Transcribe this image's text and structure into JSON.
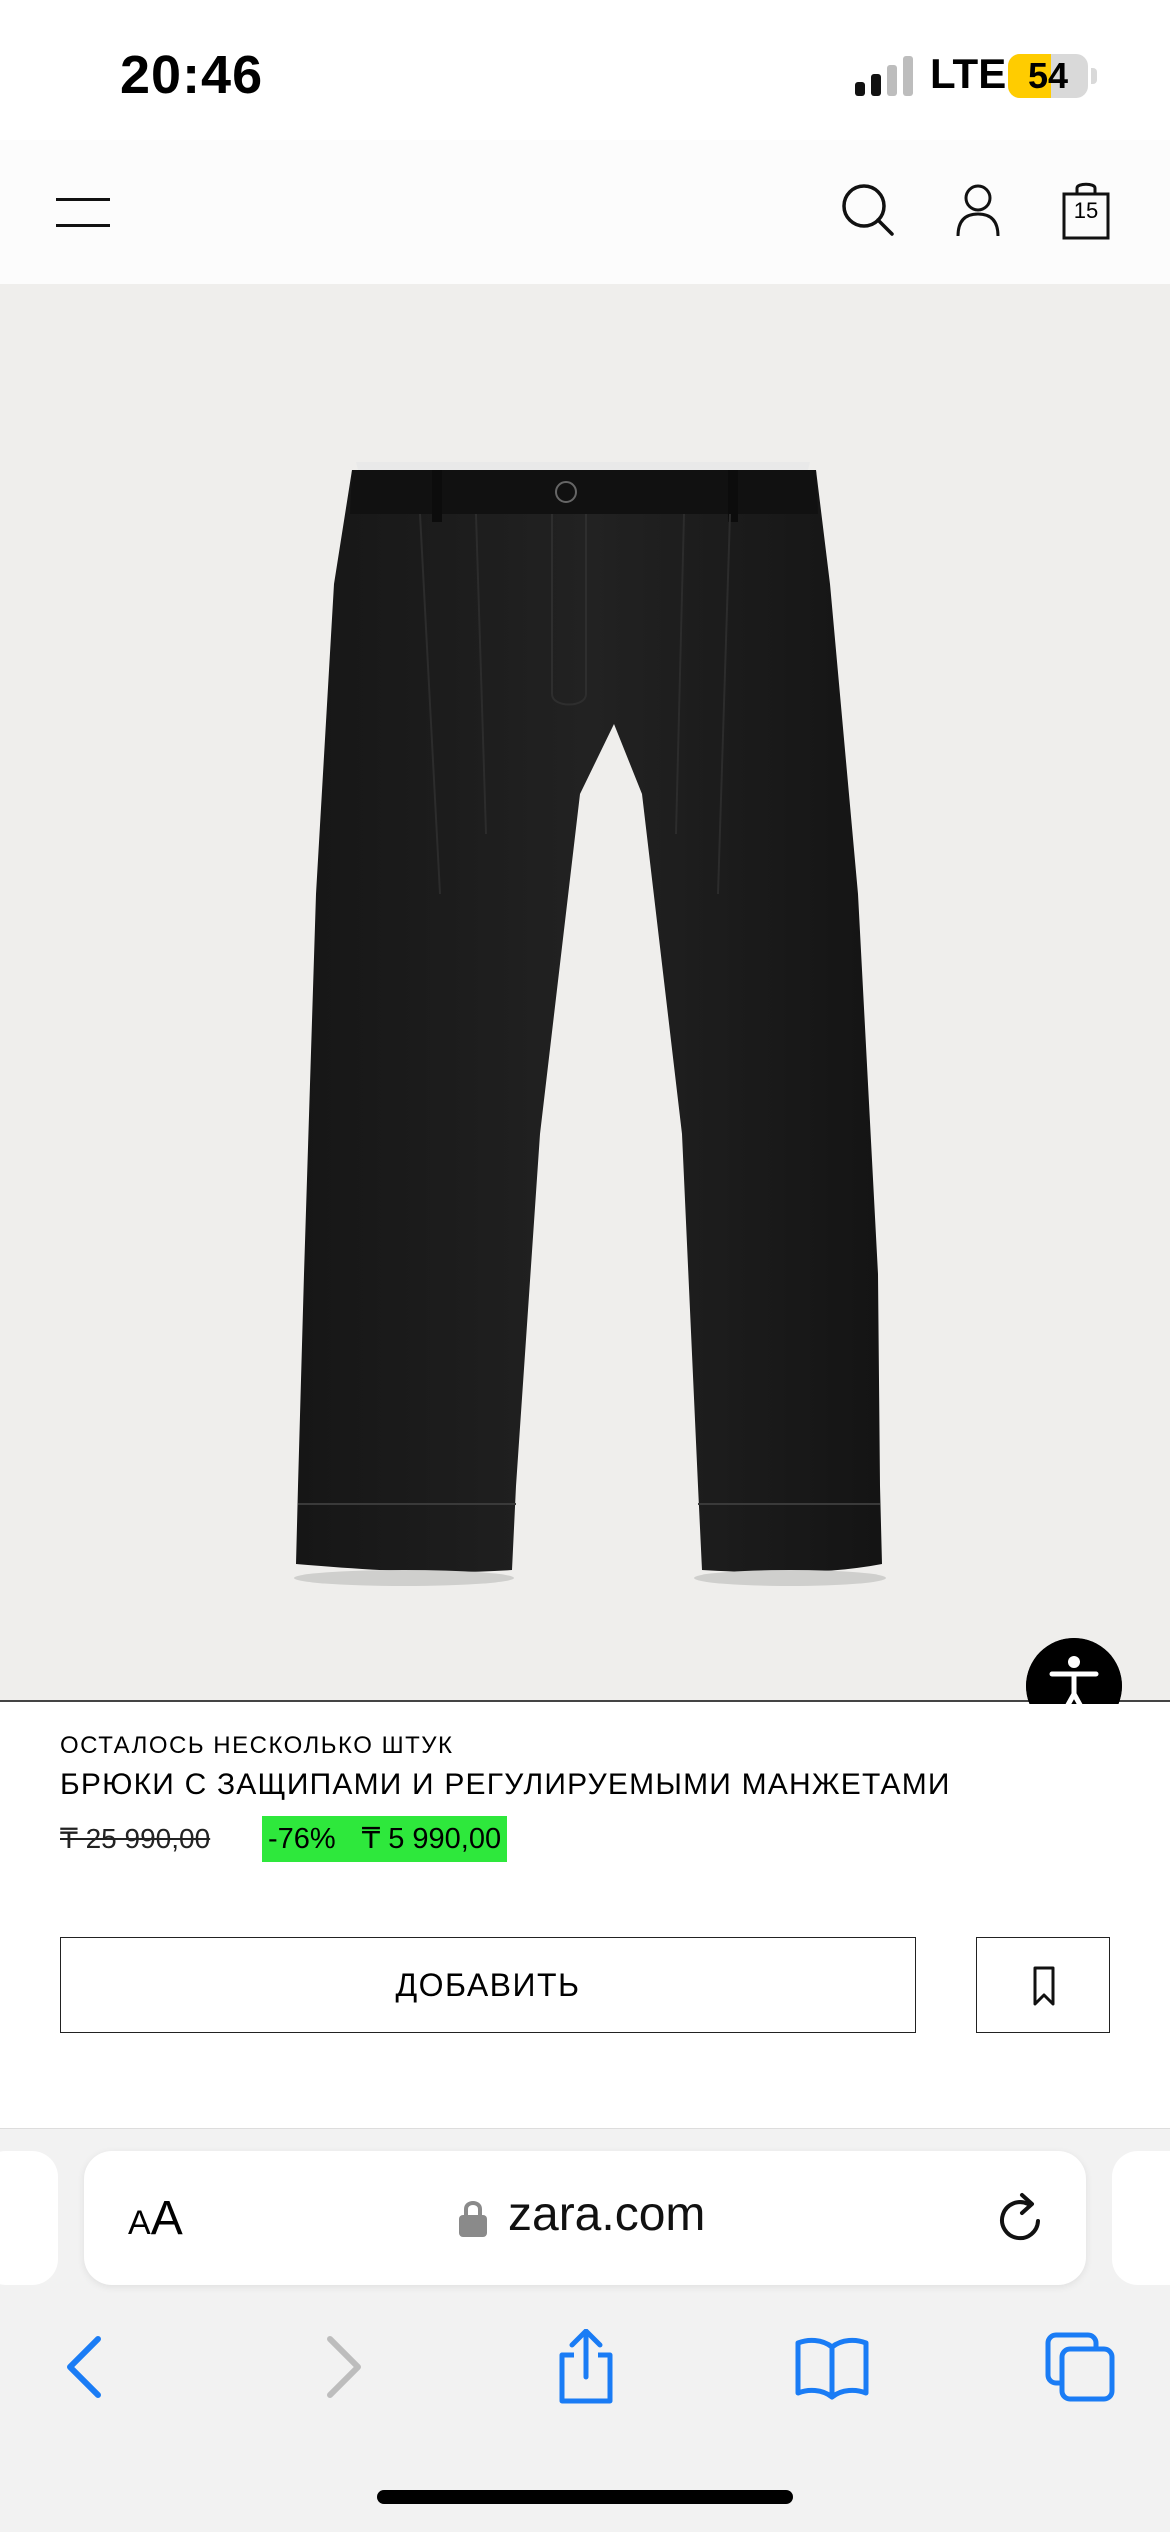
{
  "status_bar": {
    "time": "20:46",
    "network": "LTE",
    "battery": "54",
    "battery_level": 0.54
  },
  "header": {
    "cart_count": "15"
  },
  "product": {
    "stock_notice": "ОСТАЛОСЬ НЕСКОЛЬКО ШТУК",
    "name": "БРЮКИ С ЗАЩИПАМИ И РЕГУЛИРУЕМЫМИ МАНЖЕТАМИ",
    "old_price": "₸ 25 990,00",
    "discount": "-76%",
    "price": "₸ 5 990,00",
    "add_label": "ДОБАВИТЬ"
  },
  "browser": {
    "text_size_small": "A",
    "text_size_large": "A",
    "domain": "zara.com"
  },
  "colors": {
    "sale_highlight": "#2ee83c",
    "battery_yellow": "#ffcc00",
    "ios_blue": "#1a7cf5",
    "image_bg": "#efeeec"
  }
}
